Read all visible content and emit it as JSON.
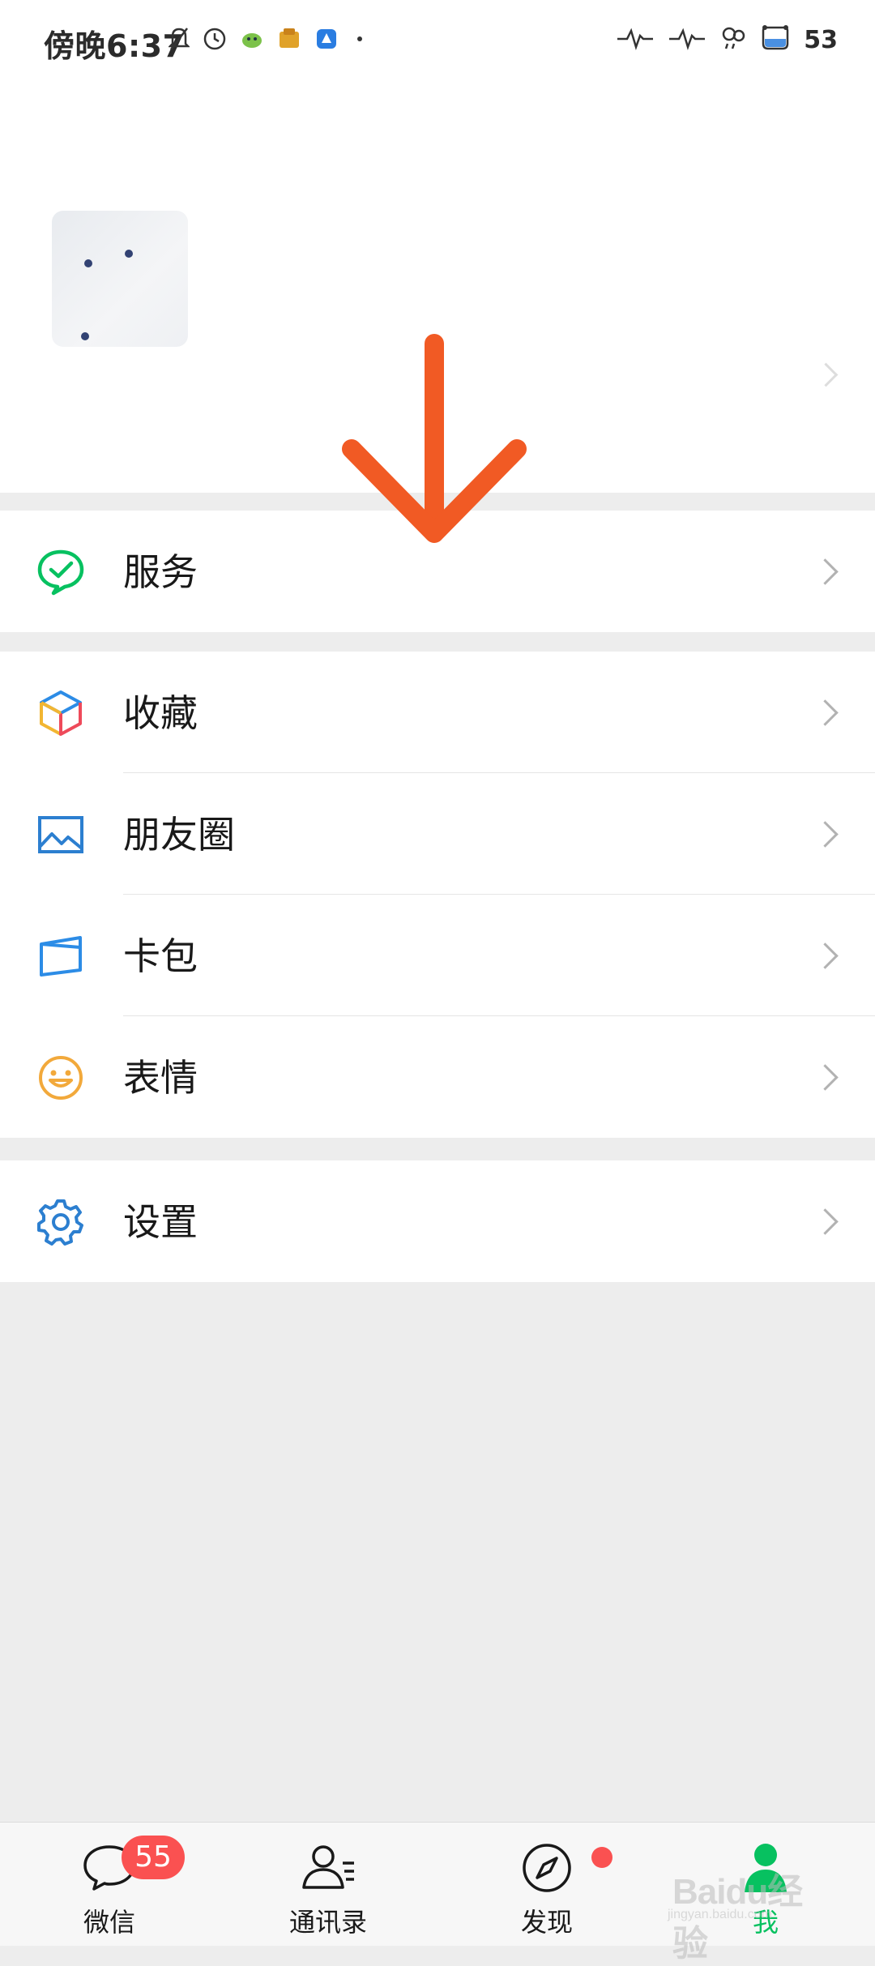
{
  "status_bar": {
    "time": "傍晚6:37",
    "battery": "53"
  },
  "menu": {
    "services": {
      "label": "服务",
      "icon": "services-check-icon"
    },
    "favorites": {
      "label": "收藏",
      "icon": "cube-icon"
    },
    "moments": {
      "label": "朋友圈",
      "icon": "image-icon"
    },
    "cards": {
      "label": "卡包",
      "icon": "card-icon"
    },
    "stickers": {
      "label": "表情",
      "icon": "smiley-icon"
    },
    "settings": {
      "label": "设置",
      "icon": "gear-icon"
    }
  },
  "tabbar": {
    "chats": {
      "label": "微信",
      "badge": "55",
      "icon": "chat-bubble-icon"
    },
    "contacts": {
      "label": "通讯录",
      "icon": "contacts-icon"
    },
    "discover": {
      "label": "发现",
      "icon": "compass-icon"
    },
    "me": {
      "label": "我",
      "icon": "person-icon"
    }
  },
  "watermark": {
    "text": "Baidu经验",
    "sub": "jingyan.baidu.com"
  },
  "colors": {
    "accent_green": "#07c160",
    "badge_red": "#fa5151",
    "arrow_orange": "#f15a24",
    "background": "#ededed"
  }
}
